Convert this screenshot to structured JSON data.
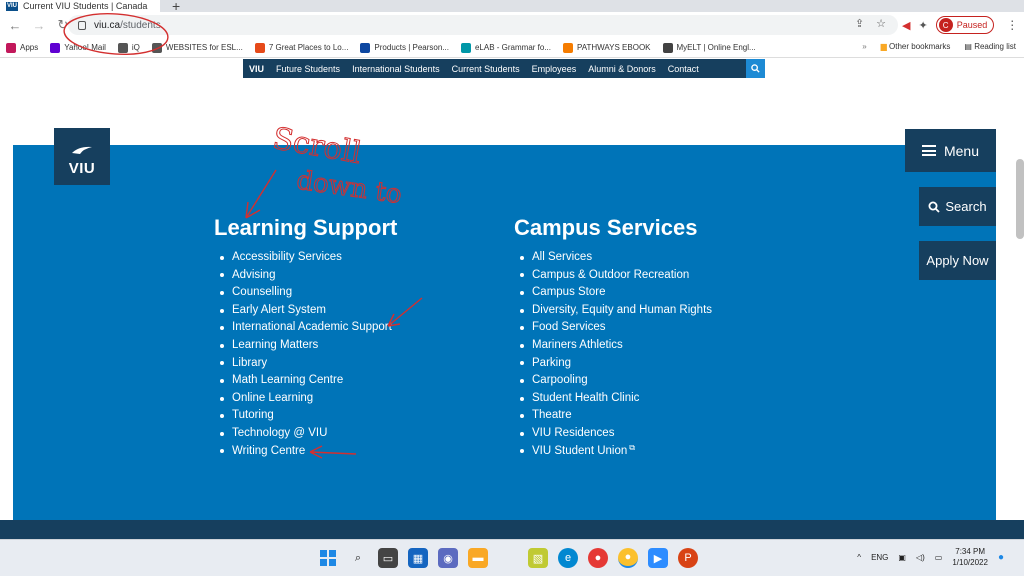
{
  "browser": {
    "tab_title": "Current VIU Students | Canada",
    "url_host": "viu.ca",
    "url_path": "/students",
    "profile_initial": "C",
    "profile_status": "Paused",
    "bookmarks": [
      {
        "label": "Apps",
        "color": "#c2185b"
      },
      {
        "label": "Yahoo! Mail",
        "color": "#6001d2"
      },
      {
        "label": "iQ",
        "color": "#555555"
      },
      {
        "label": "WEBSITES for ESL...",
        "color": "#555555"
      },
      {
        "label": "7 Great Places to Lo...",
        "color": "#e64a19"
      },
      {
        "label": "Products | Pearson...",
        "color": "#0d47a1"
      },
      {
        "label": "eLAB - Grammar fo...",
        "color": "#0097a7"
      },
      {
        "label": "PATHWAYS EBOOK",
        "color": "#f57c00"
      },
      {
        "label": "MyELT | Online Engl...",
        "color": "#424242"
      }
    ],
    "other_bookmarks": "Other bookmarks",
    "reading_list": "Reading list"
  },
  "site": {
    "nav": [
      "VIU",
      "Future Students",
      "International Students",
      "Current Students",
      "Employees",
      "Alumni & Donors",
      "Contact"
    ],
    "logo_text": "VIU",
    "menu_label": "Menu",
    "search_label": "Search",
    "apply_label": "Apply Now",
    "learning_support": {
      "heading": "Learning Support",
      "items": [
        "Accessibility Services",
        "Advising",
        "Counselling",
        "Early Alert System",
        "International Academic Support",
        "Learning Matters",
        "Library",
        "Math Learning Centre",
        "Online Learning",
        "Tutoring",
        "Technology @ VIU",
        "Writing Centre"
      ]
    },
    "campus_services": {
      "heading": "Campus Services",
      "items": [
        "All Services",
        "Campus & Outdoor Recreation",
        "Campus Store",
        "Diversity, Equity and Human Rights",
        "Food Services",
        "Mariners Athletics",
        "Parking",
        "Carpooling",
        "Student Health Clinic",
        "Theatre",
        "VIU Residences",
        "VIU Student Union"
      ]
    }
  },
  "annotation": {
    "line1": "Scroll",
    "line2": "down to",
    "color": "#d32f2f"
  },
  "taskbar": {
    "lang": "ENG",
    "time": "7:34 PM",
    "date": "1/10/2022"
  },
  "colors": {
    "panel": "#0074b8",
    "navy": "#163f5e",
    "accent": "#1d8ad4"
  }
}
